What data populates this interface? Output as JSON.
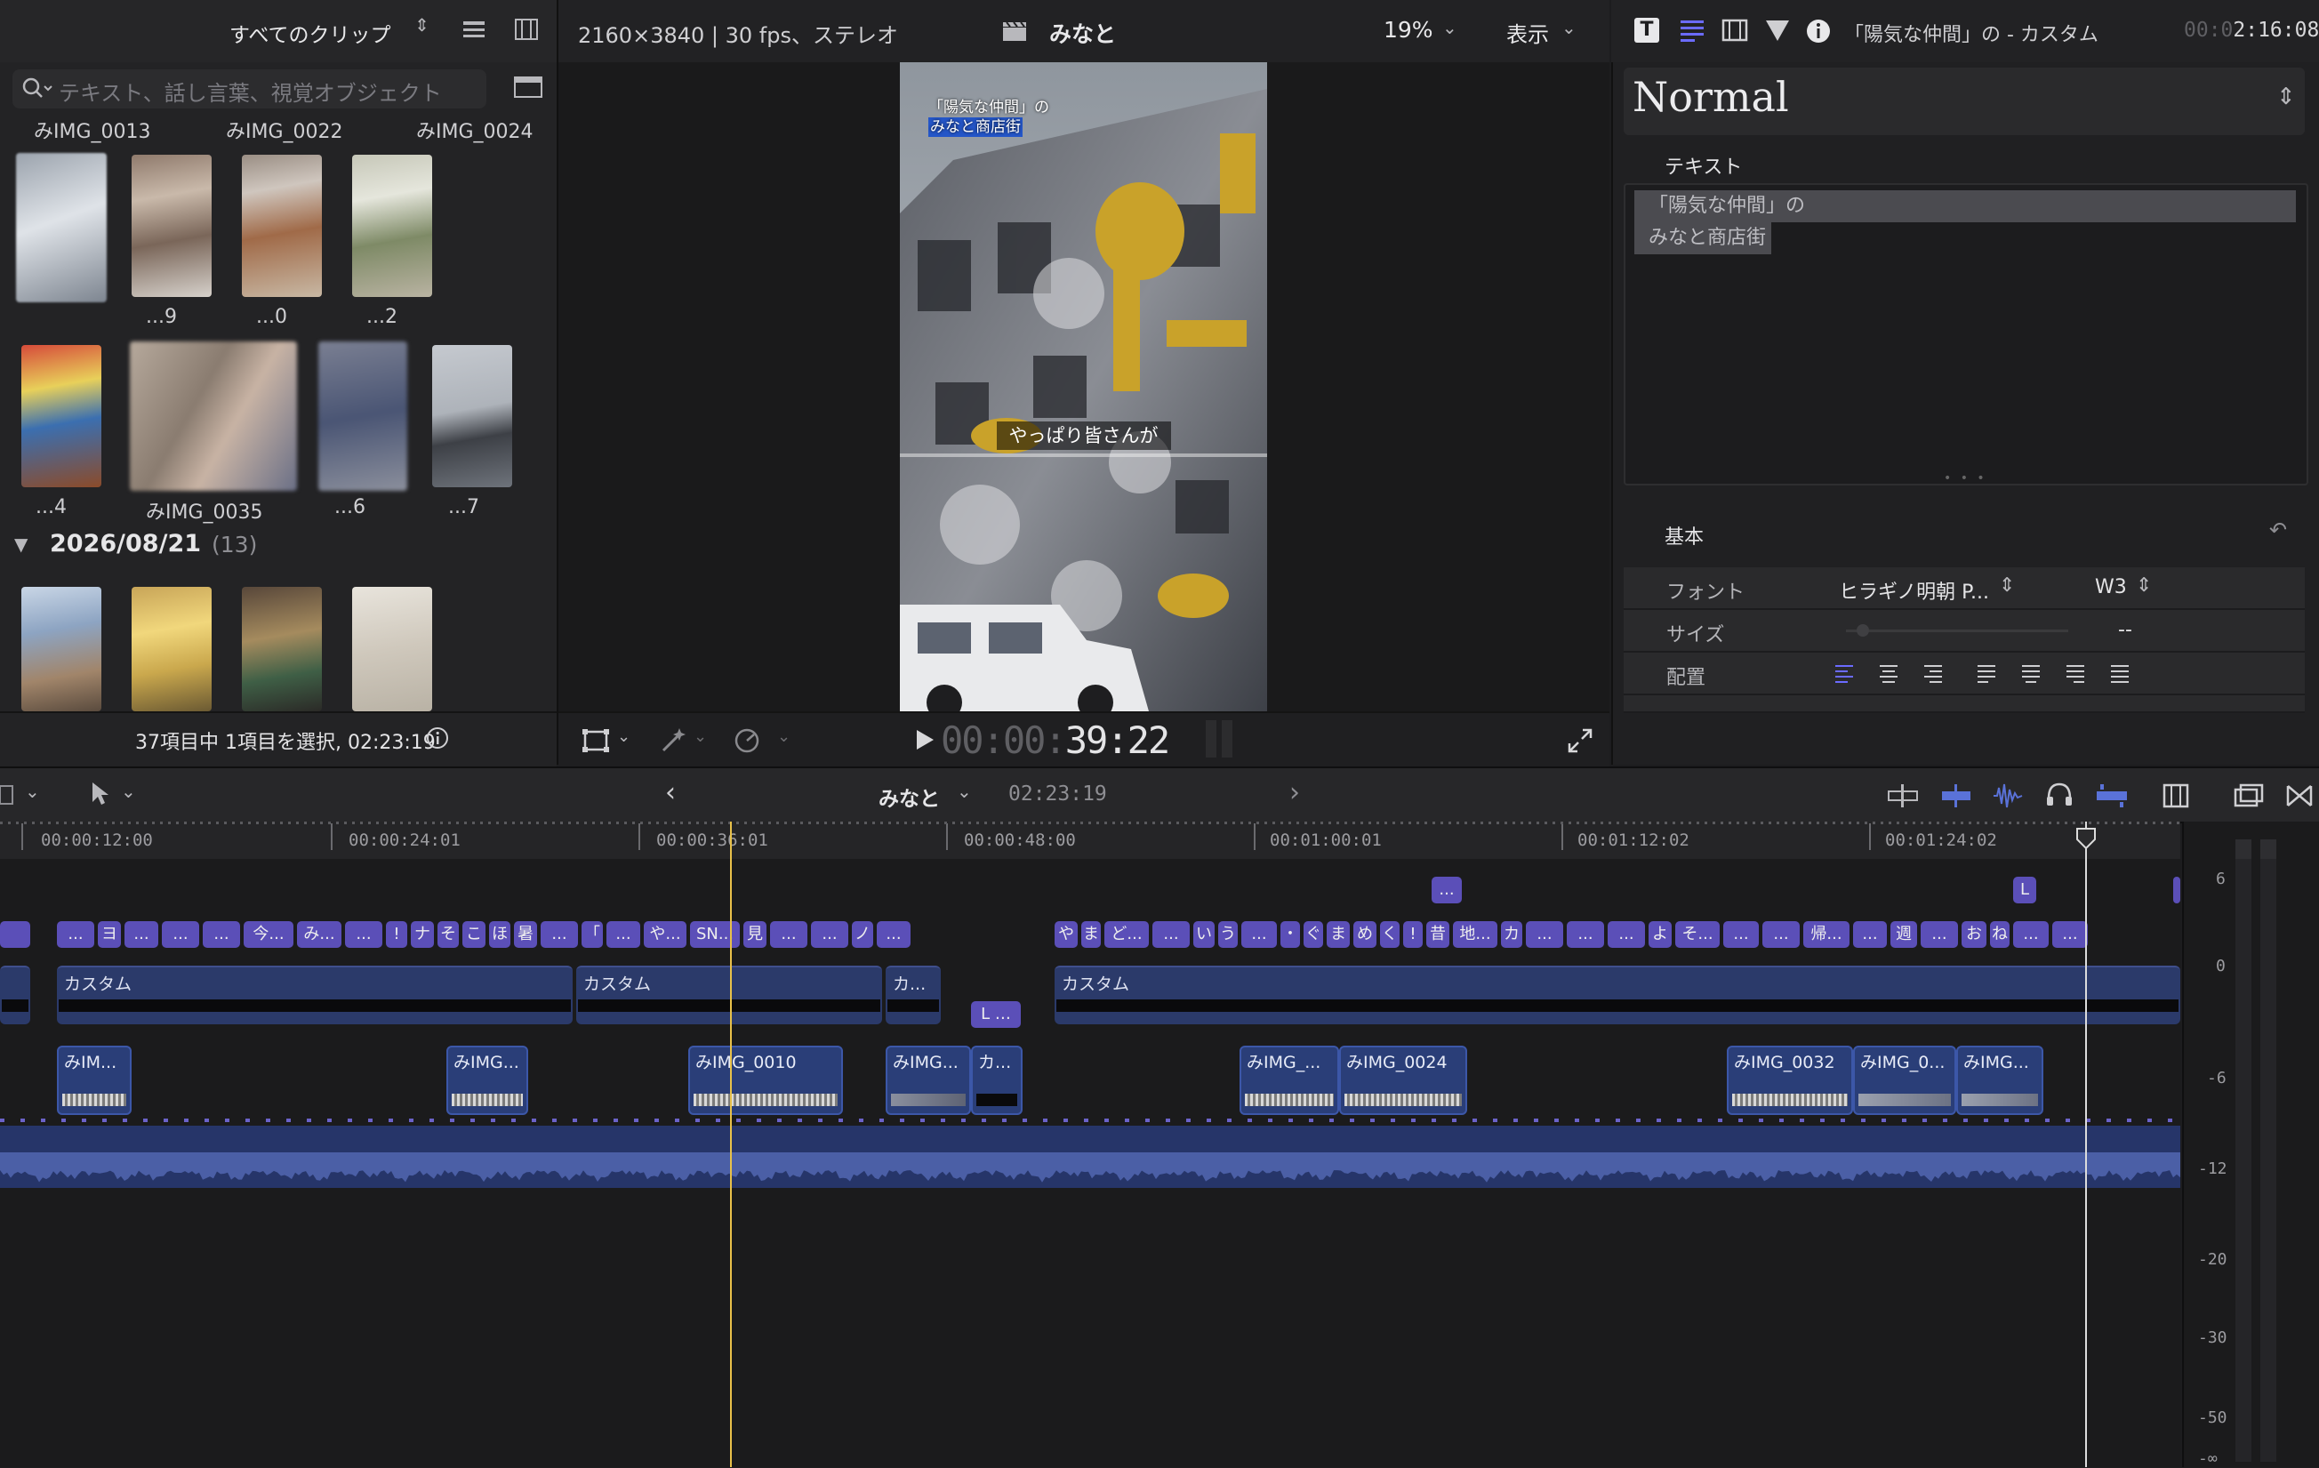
{
  "browser": {
    "filter_label": "すべてのクリップ",
    "search_placeholder": "テキスト、話し言葉、視覚オブジェクト",
    "row_titles": [
      "みIMG_0013",
      "みIMG_0022",
      "みIMG_0024"
    ],
    "row1_captions": [
      "...9",
      "...0",
      "...2"
    ],
    "row2_captions": [
      "...4",
      "みIMG_0035",
      "...6",
      "...7"
    ],
    "date_header": "2026/08/21",
    "date_count": "(13)",
    "status": "37項目中 1項目を選択, 02:23:19"
  },
  "viewer": {
    "format": "2160×3840 | 30 fps、ステレオ",
    "project": "みなと",
    "zoom": "19%",
    "view_menu": "表示",
    "overlay_title_line1": "「陽気な仲間」の",
    "overlay_title_line2": "みなと商店街",
    "overlay_caption": "やっぱり皆さんが",
    "timecode_dim": "00:00:",
    "timecode_bright": "39:22"
  },
  "inspector": {
    "header_title": "「陽気な仲間」の - カスタム",
    "header_time_dim": "00:0",
    "header_time_bright": "2:16:08",
    "preset": "Normal",
    "text_section": "テキスト",
    "text_line1": "「陽気な仲間」の",
    "text_line2": "みなと商店街",
    "basic_section": "基本",
    "font_label": "フォント",
    "font_value": "ヒラギノ明朝 P...",
    "weight_value": "W3",
    "size_label": "サイズ",
    "size_value": "--",
    "align_label": "配置"
  },
  "timeline": {
    "project": "みなと",
    "duration": "02:23:19",
    "ruler": [
      "00:00:12:00",
      "00:00:24:01",
      "00:00:36:01",
      "00:00:48:00",
      "00:01:00:01",
      "00:01:12:02",
      "00:01:24:02"
    ],
    "caption_clips": [
      "カスタム",
      "カスタム",
      "カ...",
      "カスタム"
    ],
    "video_clips": [
      "みIM...",
      "みIMG...",
      "みIMG_0010",
      "みIMG...",
      "カ...",
      "みIMG_...",
      "みIMG_0024",
      "みIMG_0032",
      "みIMG_0...",
      "みIMG..."
    ],
    "title_labels_a": [
      "...",
      "ヨ",
      "...",
      "...",
      "...",
      "今...",
      "み...",
      "...",
      "!",
      "ナ",
      "そ",
      "こ",
      "ほ",
      "暑",
      "...",
      "「",
      "...",
      "や...",
      "SN...",
      "見",
      "...",
      "...",
      "ノ",
      "..."
    ],
    "title_labels_b": [
      "や",
      "ま",
      "ど...",
      "...",
      "い",
      "う",
      "...",
      "・",
      "ぐ",
      "ま",
      "め",
      "く",
      "!",
      "昔",
      "地...",
      "カ",
      "...",
      "...",
      "...",
      "よ",
      "そ...",
      "...",
      "...",
      "帰...",
      "...",
      "週",
      "...",
      "お",
      "ね",
      "...",
      "..."
    ],
    "db_scale": [
      "6",
      "0",
      "-6",
      "-12",
      "-20",
      "-30",
      "-50",
      "-∞"
    ]
  }
}
